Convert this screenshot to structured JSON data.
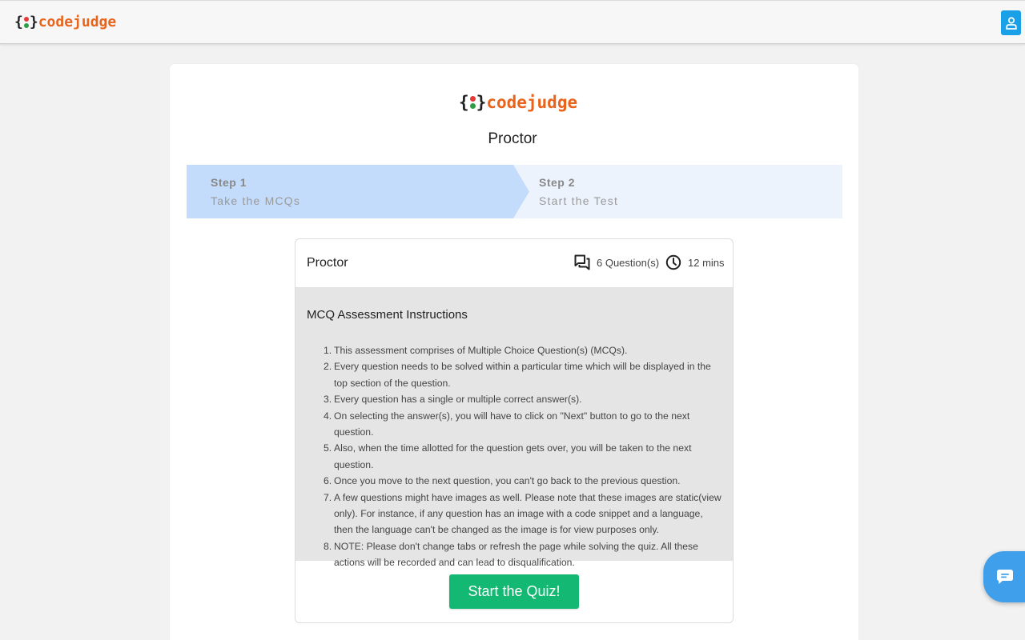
{
  "brand": {
    "name": "codejudge",
    "brace_open": "{",
    "brace_close": "}",
    "dot_top_color": "#e53935",
    "dot_bottom_color": "#2e9e44",
    "text_color": "#e8641c"
  },
  "header": {
    "user_icon": "user-icon",
    "user_button_color": "#1aa0e6"
  },
  "page": {
    "title": "Proctor"
  },
  "steps": [
    {
      "label": "Step 1",
      "sub": "Take the MCQs",
      "active": true
    },
    {
      "label": "Step 2",
      "sub": "Start the Test",
      "active": false
    }
  ],
  "quiz": {
    "title": "Proctor",
    "questions": "6 Question(s)",
    "duration": "12 mins",
    "questions_icon": "chat-bubbles-icon",
    "duration_icon": "clock-icon",
    "instructions_title": "MCQ Assessment Instructions",
    "instructions": [
      {
        "num": "1.",
        "text": "This assessment comprises of Multiple Choice Question(s) (MCQs)."
      },
      {
        "num": "2.",
        "text": "Every question needs to be solved within a particular time which will be displayed in the top section of the question."
      },
      {
        "num": "3.",
        "text": "Every question has a single or multiple correct answer(s)."
      },
      {
        "num": "4.",
        "text": "On selecting the answer(s), you will have to click on \"Next\" button to go to the next question."
      },
      {
        "num": "5.",
        "text": "Also, when the time allotted for the question gets over, you will be taken to the next question."
      },
      {
        "num": "6.",
        "text": "Once you move to the next question, you can't go back to the previous question."
      },
      {
        "num": "7.",
        "text": "A few questions might have images as well. Please note that these images are static(view only). For instance, if any question has an image with a code snippet and a language, then the language can't be changed as the image is for view purposes only."
      },
      {
        "num": "8.",
        "text": "NOTE: Please don't change tabs or refresh the page while solving the quiz. All these actions will be recorded and can lead to disqualification."
      }
    ],
    "start_label": "Start the Quiz!",
    "start_color": "#13b872"
  },
  "chat": {
    "icon": "chat-icon",
    "color": "#3f9fea"
  }
}
